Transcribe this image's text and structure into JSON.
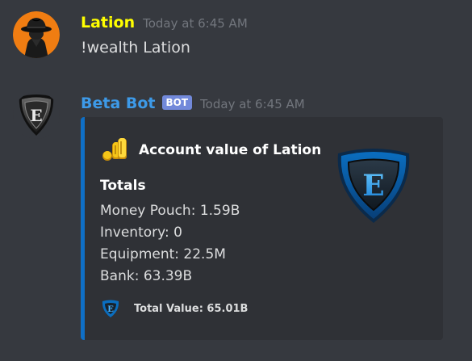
{
  "messages": [
    {
      "author": "Lation",
      "author_color": "#ffff00",
      "timestamp": "Today at 6:45 AM",
      "content": "!wealth Lation",
      "avatar_icon": "fedora-hat-icon"
    },
    {
      "author": "Beta Bot",
      "author_color": "#3d9ae8",
      "bot_tag": "BOT",
      "timestamp": "Today at 6:45 AM",
      "avatar_icon": "shield-e-logo-icon",
      "embed": {
        "bar_color": "#0f6fc6",
        "author_icon": "coins-icon",
        "author_name": "Account value of Lation",
        "thumbnail_icon": "shield-e-logo-icon",
        "field": {
          "name": "Totals",
          "lines": [
            "Money Pouch: 1.59B",
            "Inventory: 0",
            "Equipment: 22.5M",
            "Bank: 63.39B"
          ]
        },
        "footer_icon": "shield-e-logo-icon",
        "footer_text": "Total Value: 65.01B"
      }
    }
  ]
}
